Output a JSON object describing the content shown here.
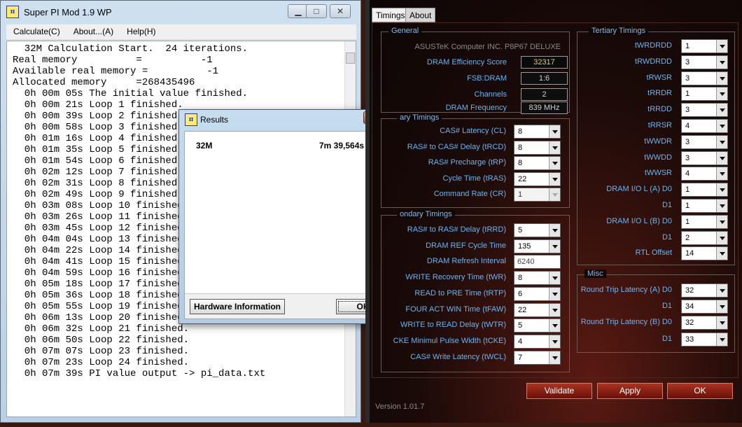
{
  "superpi": {
    "title": "Super PI Mod 1.9 WP",
    "icon_text": "SUPER π",
    "menu": [
      "Calculate(C)",
      "About...(A)",
      "Help(H)"
    ],
    "lines": [
      "  32M Calculation Start.  24 iterations.",
      "Real memory          =          -1",
      "Available real memory =          -1",
      "Allocated memory     =268435496",
      "  0h 00m 05s The initial value finished.",
      "  0h 00m 21s Loop 1 finished.",
      "  0h 00m 39s Loop 2 finished.",
      "  0h 00m 58s Loop 3 finished.",
      "  0h 01m 16s Loop 4 finished.",
      "  0h 01m 35s Loop 5 finished.",
      "  0h 01m 54s Loop 6 finished.",
      "  0h 02m 12s Loop 7 finished.",
      "  0h 02m 31s Loop 8 finished.",
      "  0h 02m 49s Loop 9 finished.",
      "  0h 03m 08s Loop 10 finished.",
      "  0h 03m 26s Loop 11 finished.",
      "  0h 03m 45s Loop 12 finished.",
      "  0h 04m 04s Loop 13 finished.",
      "  0h 04m 22s Loop 14 finished.",
      "  0h 04m 41s Loop 15 finished.",
      "  0h 04m 59s Loop 16 finished.",
      "  0h 05m 18s Loop 17 finished.",
      "  0h 05m 36s Loop 18 finished.",
      "  0h 05m 55s Loop 19 finished.",
      "  0h 06m 13s Loop 20 finished.",
      "  0h 06m 32s Loop 21 finished.",
      "  0h 06m 50s Loop 22 finished.",
      "  0h 07m 07s Loop 23 finished.",
      "  0h 07m 23s Loop 24 finished.",
      "  0h 07m 39s PI value output -> pi_data.txt"
    ]
  },
  "results": {
    "title": "Results",
    "size_label": "32M",
    "time": "7m 39,564s",
    "hardware_button": "Hardware Information",
    "ok_button": "OK"
  },
  "timings": {
    "tabs": [
      "Timings",
      "About"
    ],
    "version": "Version 1.01.7",
    "buttons": {
      "validate": "Validate",
      "apply": "Apply",
      "ok": "OK"
    },
    "general": {
      "title": "General",
      "board": "ASUSTeK Computer INC. P8P67 DELUXE",
      "efficiency_label": "DRAM Efficiency Score",
      "efficiency": "32317",
      "fsb_label": "FSB:DRAM",
      "fsb": "1:6",
      "channels_label": "Channels",
      "channels": "2",
      "freq_label": "DRAM Frequency",
      "freq": "839 MHz"
    },
    "primary": {
      "title": "ary Timings",
      "rows": [
        {
          "label": "CAS# Latency (CL)",
          "value": "8"
        },
        {
          "label": "RAS# to CAS# Delay (tRCD)",
          "value": "8"
        },
        {
          "label": "RAS# Precharge (tRP)",
          "value": "8"
        },
        {
          "label": "Cycle Time (tRAS)",
          "value": "22"
        },
        {
          "label": "Command Rate (CR)",
          "value": "1"
        }
      ]
    },
    "secondary": {
      "title": "ondary Timings",
      "rows": [
        {
          "label": "RAS# to RAS# Delay (tRRD)",
          "value": "5"
        },
        {
          "label": "DRAM REF Cycle Time",
          "value": "135"
        },
        {
          "label": "DRAM Refresh Interval",
          "value": "6240"
        },
        {
          "label": "WRITE Recovery Time (tWR)",
          "value": "8"
        },
        {
          "label": "READ to PRE Time (tRTP)",
          "value": "6"
        },
        {
          "label": "FOUR ACT WIN Time (tFAW)",
          "value": "22"
        },
        {
          "label": "WRITE to READ Delay (tWTR)",
          "value": "5"
        },
        {
          "label": "CKE Minimul Pulse Width (tCKE)",
          "value": "4"
        },
        {
          "label": "CAS# Write Latency (tWCL)",
          "value": "7"
        }
      ]
    },
    "tertiary": {
      "title": "Tertiary Timings",
      "rows": [
        {
          "label": "tWRDRDD",
          "value": "1"
        },
        {
          "label": "tRWDRDD",
          "value": "3"
        },
        {
          "label": "tRWSR",
          "value": "3"
        },
        {
          "label": "tRRDR",
          "value": "1"
        },
        {
          "label": "tRRDD",
          "value": "3"
        },
        {
          "label": "tRRSR",
          "value": "4"
        },
        {
          "label": "tWWDR",
          "value": "3"
        },
        {
          "label": "tWWDD",
          "value": "3"
        },
        {
          "label": "tWWSR",
          "value": "4"
        },
        {
          "label": "DRAM I/O L (A)  D0",
          "value": "1"
        },
        {
          "label": "D1",
          "value": "1"
        },
        {
          "label": "DRAM I/O L (B)  D0",
          "value": "1"
        },
        {
          "label": "D1",
          "value": "2"
        },
        {
          "label": "RTL Offset",
          "value": "14"
        }
      ]
    },
    "misc": {
      "title": "Misc",
      "rows": [
        {
          "label": "Round Trip Latency (A)  D0",
          "value": "32"
        },
        {
          "label": "D1",
          "value": "34"
        },
        {
          "label": "Round Trip Latency (B)  D0",
          "value": "32"
        },
        {
          "label": "D1",
          "value": "33"
        }
      ]
    }
  }
}
